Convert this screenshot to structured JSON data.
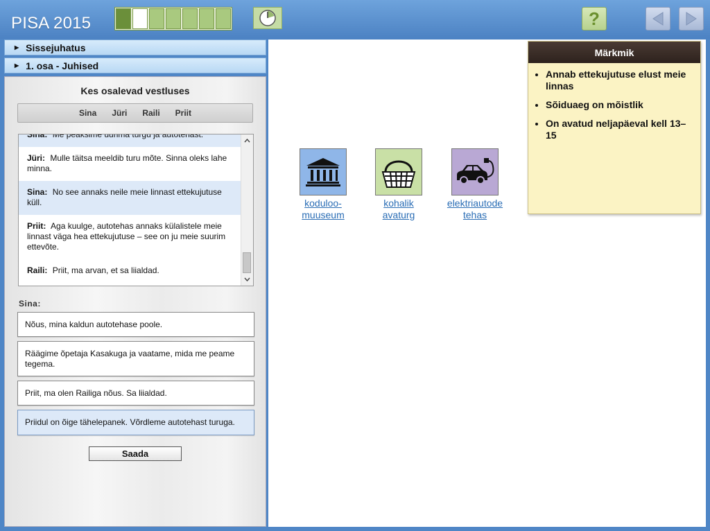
{
  "app": {
    "title": "PISA 2015"
  },
  "progress": {
    "total_units": 7,
    "current_unit": 2
  },
  "sections": {
    "intro": "Sissejuhatus",
    "part1": "1. osa - Juhised"
  },
  "panel": {
    "title": "Kes osalevad vestluses",
    "participants": [
      "Sina",
      "Jüri",
      "Raili",
      "Priit"
    ],
    "chat": [
      {
        "speaker": "Sina:",
        "text": "Me peaksime uurima turgu ja autotehast.",
        "highlight": true
      },
      {
        "speaker": "Jüri:",
        "text": "Mulle täitsa meeldib turu mõte. Sinna oleks lahe minna.",
        "highlight": false
      },
      {
        "speaker": "Sina:",
        "text": "No see annaks neile meie linnast ettekujutuse küll.",
        "highlight": true
      },
      {
        "speaker": "Priit:",
        "text": "Aga kuulge, autotehas annaks külalistele meie linnast väga hea ettekujutuse – see on ju meie suurim ettevõte.",
        "highlight": false
      },
      {
        "speaker": "Raili:",
        "text": "Priit, ma arvan, et sa liialdad.",
        "highlight": false
      }
    ],
    "speaker_label": "Sina:",
    "options": [
      "Nõus, mina kaldun autotehase poole.",
      "Räägime õpetaja Kasakuga ja vaatame, mida me peame tegema.",
      "Priit, ma olen Railiga nõus. Sa liialdad.",
      "Priidul on õige tähelepanek. Võrdleme autotehast turuga."
    ],
    "selected_option": 3,
    "send_label": "Saada"
  },
  "places": [
    {
      "label": "koduloo-muuseum",
      "line1": "koduloo-",
      "line2": "muuseum",
      "icon": "museum-icon"
    },
    {
      "label": "kohalik avaturg",
      "line1": "kohalik",
      "line2": "avaturg",
      "icon": "basket-icon"
    },
    {
      "label": "elektriautode tehas",
      "line1": "elektriautode",
      "line2": "tehas",
      "icon": "electric-car-icon"
    }
  ],
  "notes": {
    "title": "Märkmik",
    "items": [
      "Annab ettekujutuse elust meie linnas",
      "Sõiduaeg on mõistlik",
      "On avatud neljapäeval kell 13–15"
    ]
  },
  "colors": {
    "header_blue": "#4f86c6",
    "progress_green": "#6b8f3a",
    "link_blue": "#2a6db5",
    "notes_yellow": "#fbf3c4"
  }
}
